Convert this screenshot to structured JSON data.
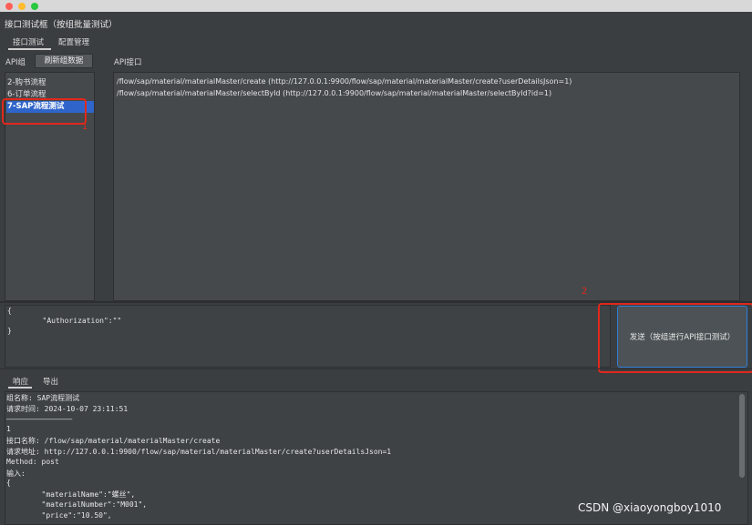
{
  "window": {
    "title": "接口测试框（按组批量测试）",
    "traffic_lights": [
      "#ff5f57",
      "#febc2e",
      "#28c840"
    ]
  },
  "tabs": [
    {
      "label": "接口测试",
      "active": true
    },
    {
      "label": "配置管理",
      "active": false
    }
  ],
  "left_panel": {
    "label": "API组",
    "refresh_label": "刷新组数据",
    "items": [
      "2-购书流程",
      "6-订单流程",
      "7-SAP流程测试"
    ],
    "selected_index": 2
  },
  "right_panel": {
    "label": "API接口",
    "items": [
      "/flow/sap/material/materialMaster/create  (http://127.0.0.1:9900/flow/sap/material/materialMaster/create?userDetailsJson=1)",
      "/flow/sap/material/materialMaster/selectById  (http://127.0.0.1:9900/flow/sap/material/materialMaster/selectById?id=1)"
    ]
  },
  "headers_editor": {
    "line1": "{",
    "line2": "        \"Authorization\":\"\"",
    "line3": "}"
  },
  "send_button": {
    "label": "发送（按组进行API接口测试）"
  },
  "annotations": {
    "marker1": "1",
    "marker2": "2",
    "color": "#e0281c"
  },
  "bottom_tabs": [
    {
      "label": "响应",
      "active": true
    },
    {
      "label": "导出",
      "active": false
    }
  ],
  "response": {
    "lines": [
      "组名称: SAP流程测试",
      "请求时间: 2024-10-07 23:11:51",
      "———————————————",
      "1",
      "接口名称: /flow/sap/material/materialMaster/create",
      "请求地址: http://127.0.0.1:9900/flow/sap/material/materialMaster/create?userDetailsJson=1",
      "Method: post",
      "输入:",
      "{",
      "        \"materialName\":\"螺丝\",",
      "        \"materialNumber\":\"M001\",",
      "        \"price\":\"10.50\","
    ]
  },
  "watermark": "CSDN @xiaoyongboy1010",
  "colors": {
    "selection": "#2f65ca",
    "focus_border": "#2e7fd6"
  }
}
